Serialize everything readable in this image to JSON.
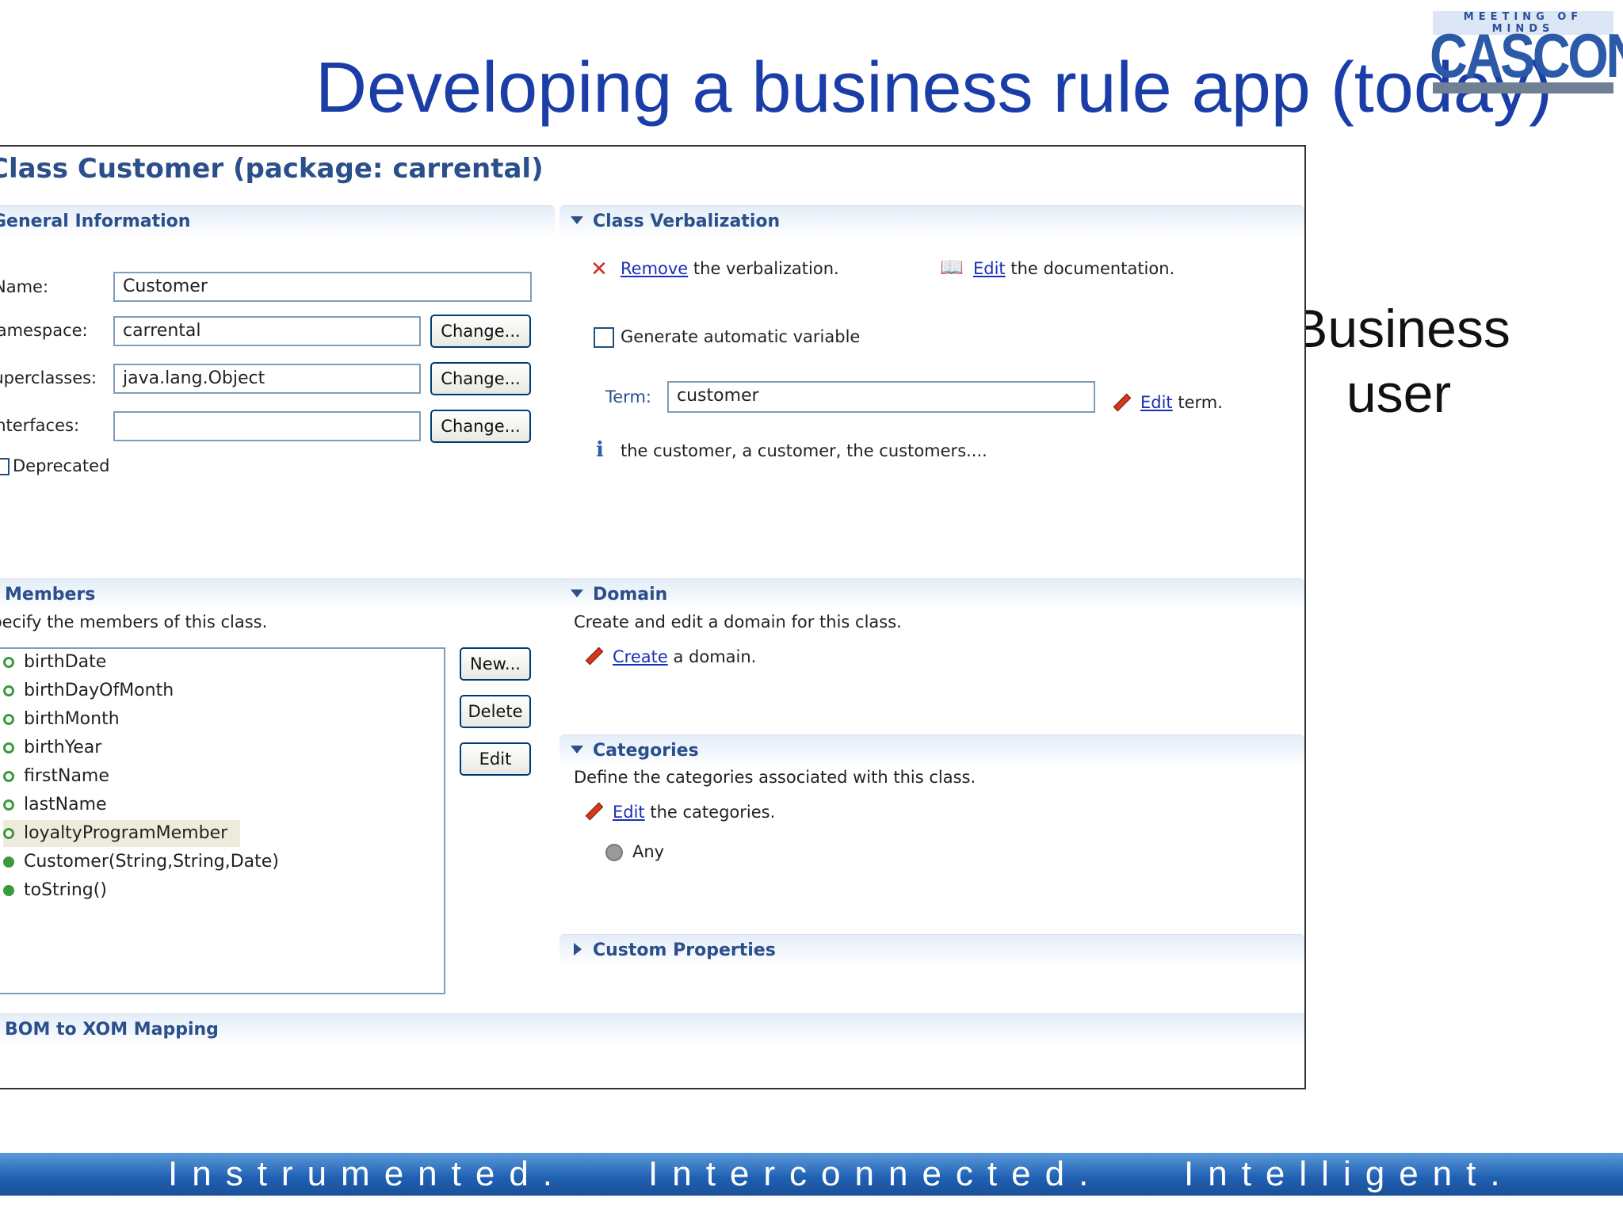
{
  "slide": {
    "title": "Developing a business rule app (today)",
    "side_text_line1": "Business",
    "side_text_line2": "user",
    "logo_top": "MEETING OF MINDS",
    "logo_main": "CASCON",
    "footer": [
      "Instrumented.",
      "Interconnected.",
      "Intelligent."
    ]
  },
  "editor": {
    "class_title": "Class Customer (package: carrental)",
    "general": {
      "header": "General Information",
      "name_label": "Name:",
      "name_value": "Customer",
      "namespace_label": "Namespace:",
      "namespace_value": "carrental",
      "superclasses_label": "Superclasses:",
      "superclasses_value": "java.lang.Object",
      "interfaces_label": "Interfaces:",
      "interfaces_value": "",
      "change_label": "Change...",
      "deprecated_label": "Deprecated"
    },
    "verbalization": {
      "header": "Class Verbalization",
      "remove_link": "Remove",
      "remove_text": "the verbalization.",
      "edit_link": "Edit",
      "doc_text": "the documentation.",
      "auto_var_label": "Generate automatic variable",
      "term_label": "Term:",
      "term_value": "customer",
      "term_suffix": "term.",
      "info_text": "the customer, a customer, the customers...."
    },
    "members": {
      "header": "Members",
      "description": "Specify the members of this class.",
      "items": [
        {
          "label": "birthDate",
          "kind": "attribute"
        },
        {
          "label": "birthDayOfMonth",
          "kind": "attribute"
        },
        {
          "label": "birthMonth",
          "kind": "attribute"
        },
        {
          "label": "birthYear",
          "kind": "attribute"
        },
        {
          "label": "firstName",
          "kind": "attribute"
        },
        {
          "label": "lastName",
          "kind": "attribute"
        },
        {
          "label": "loyaltyProgramMember",
          "kind": "attribute",
          "selected": true
        },
        {
          "label": "Customer(String,String,Date)",
          "kind": "constructor"
        },
        {
          "label": "toString()",
          "kind": "method"
        }
      ],
      "new_label": "New...",
      "delete_label": "Delete",
      "edit_label": "Edit"
    },
    "domain": {
      "header": "Domain",
      "description": "Create and edit a domain for this class.",
      "create_link": "Create",
      "create_text": "a domain."
    },
    "categories": {
      "header": "Categories",
      "description": "Define the categories associated with this class.",
      "edit_link": "Edit",
      "edit_text": "the categories.",
      "any_label": "Any"
    },
    "custom_properties": {
      "header": "Custom Properties"
    },
    "bom_mapping": {
      "header": "BOM to XOM Mapping"
    }
  }
}
